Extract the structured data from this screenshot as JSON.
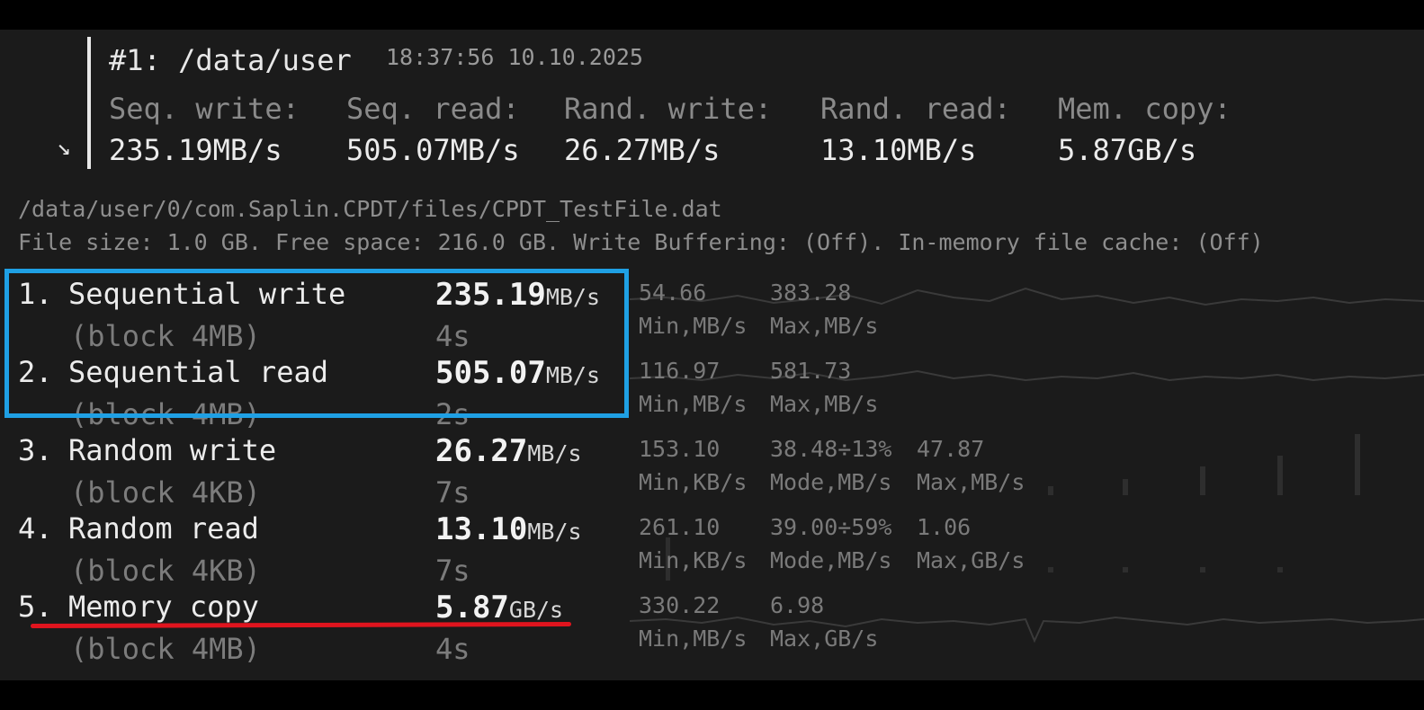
{
  "header": {
    "title": "#1: /data/user",
    "timestamp": "18:37:56 10.10.2025",
    "summary": [
      {
        "label": "Seq. write:",
        "value": "235.19MB/s"
      },
      {
        "label": "Seq. read:",
        "value": "505.07MB/s"
      },
      {
        "label": "Rand. write:",
        "value": "26.27MB/s"
      },
      {
        "label": "Rand. read:",
        "value": "13.10MB/s"
      },
      {
        "label": "Mem. copy:",
        "value": "5.87GB/s"
      }
    ]
  },
  "info": {
    "path": "/data/user/0/com.Saplin.CPDT/files/CPDT_TestFile.dat",
    "details": "File size: 1.0 GB. Free space: 216.0 GB. Write Buffering: (Off). In-memory file cache: (Off)"
  },
  "tests": [
    {
      "num": "1.",
      "name": "Sequential write",
      "block": "(block 4MB)",
      "speed": "235.19",
      "unit": "MB/s",
      "time": "4s",
      "stats": [
        {
          "value": "54.66",
          "label": "Min,MB/s"
        },
        {
          "value": "383.28",
          "label": "Max,MB/s"
        }
      ]
    },
    {
      "num": "2.",
      "name": "Sequential read",
      "block": "(block 4MB)",
      "speed": "505.07",
      "unit": "MB/s",
      "time": "2s",
      "stats": [
        {
          "value": "116.97",
          "label": "Min,MB/s"
        },
        {
          "value": "581.73",
          "label": "Max,MB/s"
        }
      ]
    },
    {
      "num": "3.",
      "name": "Random write",
      "block": "(block 4KB)",
      "speed": "26.27",
      "unit": "MB/s",
      "time": "7s",
      "stats": [
        {
          "value": "153.10",
          "label": "Min,KB/s"
        },
        {
          "value": "38.48÷13%",
          "label": "Mode,MB/s"
        },
        {
          "value": "47.87",
          "label": "Max,MB/s"
        }
      ]
    },
    {
      "num": "4.",
      "name": "Random read",
      "block": "(block 4KB)",
      "speed": "13.10",
      "unit": "MB/s",
      "time": "7s",
      "stats": [
        {
          "value": "261.10",
          "label": "Min,KB/s"
        },
        {
          "value": "39.00÷59%",
          "label": "Mode,MB/s"
        },
        {
          "value": "1.06",
          "label": "Max,GB/s"
        }
      ]
    },
    {
      "num": "5.",
      "name": "Memory copy",
      "block": "(block 4MB)",
      "speed": "5.87",
      "unit": "GB/s",
      "time": "4s",
      "stats": [
        {
          "value": "330.22",
          "label": "Min,MB/s"
        },
        {
          "value": "6.98",
          "label": "Max,GB/s"
        }
      ]
    }
  ],
  "icons": {
    "collapse": "arrow-down-right-icon"
  },
  "colors": {
    "highlight_box": "#1fa0e4",
    "underline": "#e0141e"
  }
}
